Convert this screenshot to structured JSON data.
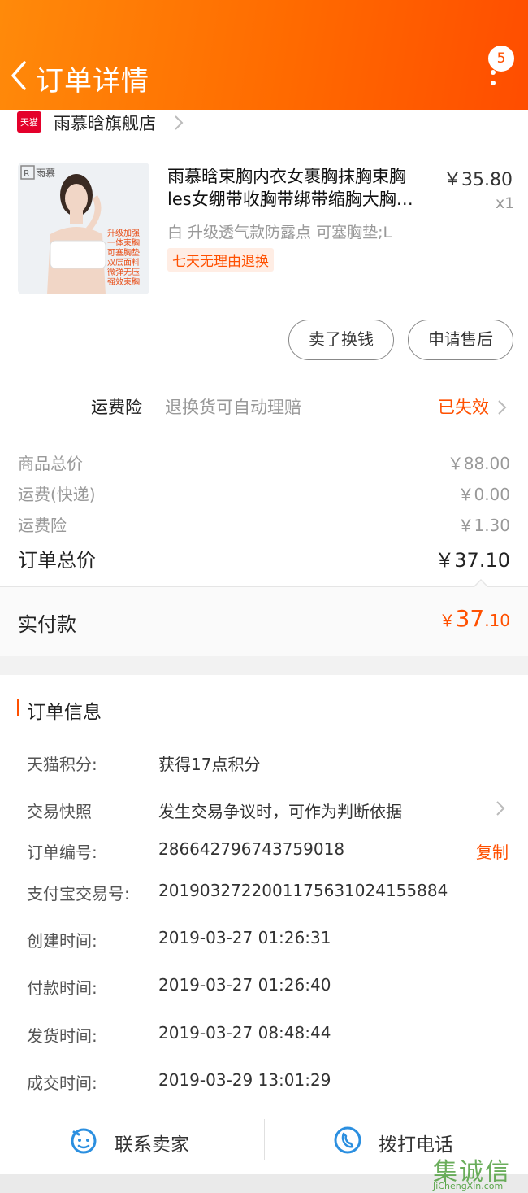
{
  "header": {
    "title": "订单详情",
    "more_badge": "5",
    "accent": "#ff6a00"
  },
  "store": {
    "logo_text": "天猫",
    "name": "雨慕晗旗舰店"
  },
  "product": {
    "image_brand": "雨慕",
    "image_features": [
      "升级加强",
      "一体束胸",
      "可塞胸垫",
      "双层面料",
      "微弹无压",
      "强效束胸"
    ],
    "title_line1": "雨慕晗束胸内衣女裹胸抹胸束胸",
    "title_line2": "les女绷带收胸带绑带缩胸大胸…",
    "price": "￥35.80",
    "qty": "x1",
    "sku": "白 升级透气款防露点 可塞胸垫;L",
    "tag": "七天无理由退换"
  },
  "actions": {
    "sell_label": "卖了换钱",
    "service_label": "申请售后"
  },
  "insurance": {
    "label": "运费险",
    "desc": "退换货可自动理赔",
    "status": "已失效"
  },
  "fees": {
    "goods_label": "商品总价",
    "goods_value": "￥88.00",
    "shipping_label": "运费(快递)",
    "shipping_value": "￥0.00",
    "insurance_label": "运费险",
    "insurance_value": "￥1.30",
    "total_label": "订单总价",
    "total_value": "￥37.10"
  },
  "paid": {
    "label": "实付款",
    "symbol": "￥",
    "integer": "37",
    "decimal": ".10"
  },
  "order_info": {
    "title": "订单信息",
    "rows": [
      {
        "key": "天猫积分:",
        "value": "获得17点积分"
      },
      {
        "key": "交易快照",
        "value": "发生交易争议时，可作为判断依据"
      },
      {
        "key": "订单编号:",
        "value": "286642796743759018"
      },
      {
        "key": "支付宝交易号:",
        "value": "2019032722001175631024155884"
      },
      {
        "key": "创建时间:",
        "value": "2019-03-27 01:26:31"
      },
      {
        "key": "付款时间:",
        "value": "2019-03-27 01:26:40"
      },
      {
        "key": "发货时间:",
        "value": "2019-03-27 08:48:44"
      },
      {
        "key": "成交时间:",
        "value": "2019-03-29 13:01:29"
      }
    ],
    "copy_label": "复制"
  },
  "bottom_bar": {
    "contact_label": "联系卖家",
    "call_label": "拨打电话"
  },
  "watermark": {
    "text": "集诚信",
    "sub": "JiChengXin.com"
  }
}
